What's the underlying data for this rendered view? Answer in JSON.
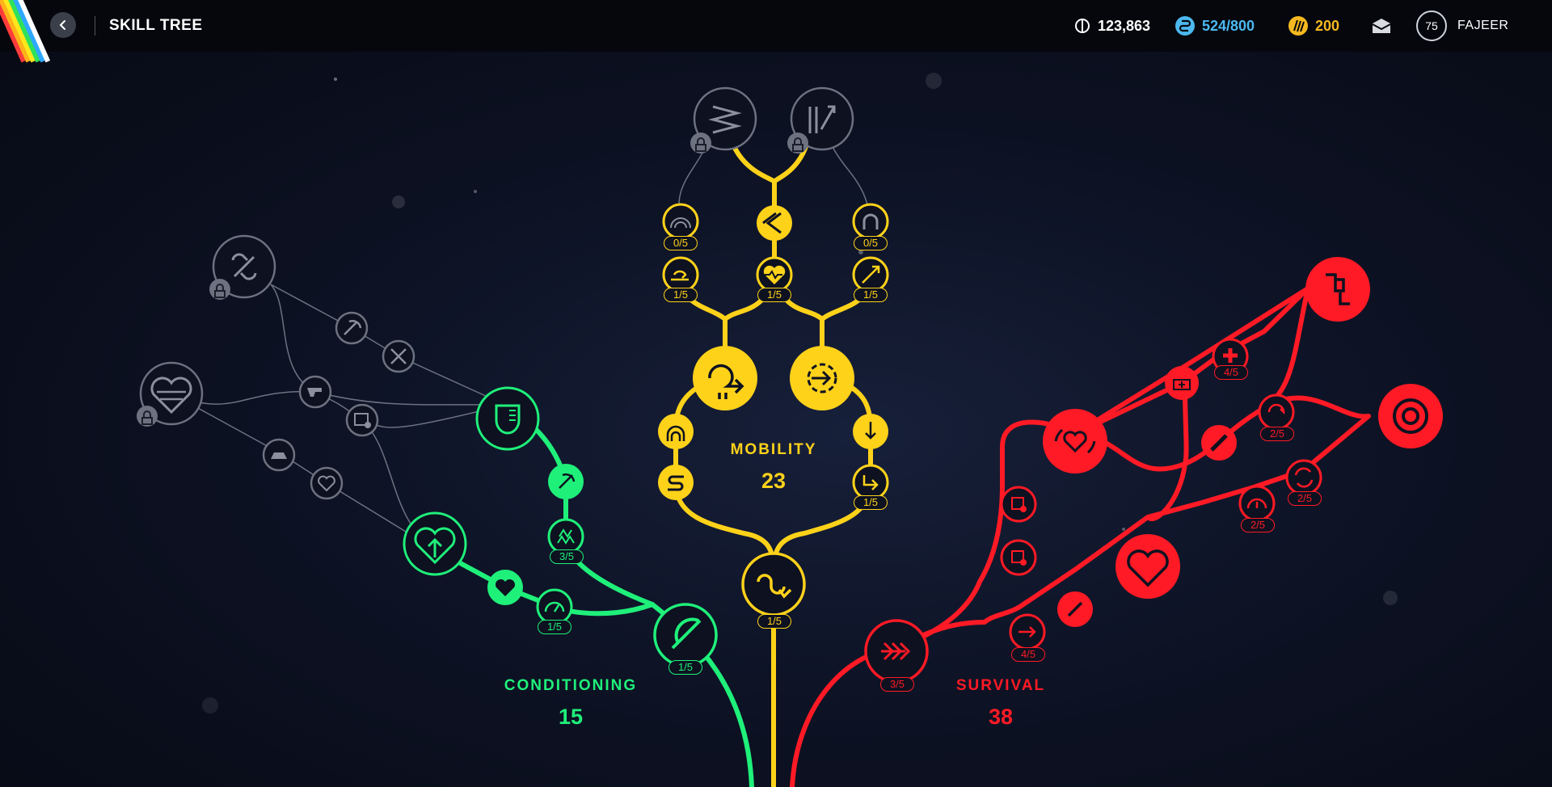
{
  "header": {
    "title": "SKILL TREE",
    "currency_1": "123,863",
    "currency_2": "524/800",
    "currency_3": "200",
    "level": "75",
    "username": "FAJEER"
  },
  "branches": {
    "mobility": {
      "name": "MOBILITY",
      "points": "23"
    },
    "conditioning": {
      "name": "CONDITIONING",
      "points": "15"
    },
    "survival": {
      "name": "SURVIVAL",
      "points": "38"
    }
  },
  "colors": {
    "mobility": "#ffd21a",
    "conditioning": "#1ff07a",
    "survival": "#ff1a25",
    "locked": "#6c7280",
    "currency_2": "#4cb8f0",
    "currency_3": "#f5b820"
  },
  "nodes": {
    "mobility": [
      {
        "id": "mob-locked-a",
        "icon": "zigzag-icon",
        "state": "locked"
      },
      {
        "id": "mob-locked-b",
        "icon": "diagonal-arrow-icon",
        "state": "locked"
      },
      {
        "id": "mob-a",
        "icon": "arc-icon",
        "rank": "0/5"
      },
      {
        "id": "mob-b",
        "icon": "chevron-icon"
      },
      {
        "id": "mob-c",
        "icon": "magnet-icon",
        "rank": "0/5"
      },
      {
        "id": "mob-d",
        "icon": "slide-icon",
        "rank": "1/5"
      },
      {
        "id": "mob-e",
        "icon": "heart-pulse-icon",
        "rank": "1/5"
      },
      {
        "id": "mob-f",
        "icon": "arrow-up-right-icon",
        "rank": "1/5"
      },
      {
        "id": "mob-g",
        "icon": "swirl-arrow-icon"
      },
      {
        "id": "mob-h",
        "icon": "dash-circle-icon"
      },
      {
        "id": "mob-i",
        "icon": "triple-arch-icon"
      },
      {
        "id": "mob-j",
        "icon": "drop-arrow-icon"
      },
      {
        "id": "mob-k",
        "icon": "s-curve-icon"
      },
      {
        "id": "mob-l",
        "icon": "corner-arrow-icon",
        "rank": "1/5"
      },
      {
        "id": "mob-root",
        "icon": "wave-arrow-icon",
        "rank": "1/5"
      }
    ],
    "conditioning": [
      {
        "id": "con-root",
        "icon": "feather-icon",
        "rank": "1/5"
      },
      {
        "id": "con-a",
        "icon": "shield-icon"
      },
      {
        "id": "con-b",
        "icon": "pickaxe-icon"
      },
      {
        "id": "con-c",
        "icon": "grass-icon",
        "rank": "3/5"
      },
      {
        "id": "con-d",
        "icon": "heart-arrow-icon"
      },
      {
        "id": "con-e",
        "icon": "heart-icon"
      },
      {
        "id": "con-f",
        "icon": "speed-icon",
        "rank": "1/5"
      }
    ],
    "survival": [
      {
        "id": "sur-root",
        "icon": "triple-chevron-icon",
        "rank": "3/5"
      },
      {
        "id": "sur-a",
        "icon": "arrow-icon",
        "rank": "4/5"
      },
      {
        "id": "sur-b",
        "icon": "wrench-icon"
      },
      {
        "id": "sur-c",
        "icon": "heart-refresh-icon"
      },
      {
        "id": "sur-d",
        "icon": "gauge-icon",
        "rank": "2/5"
      },
      {
        "id": "sur-e",
        "icon": "cycle-icon",
        "rank": "2/5"
      },
      {
        "id": "sur-f",
        "icon": "target-icon"
      },
      {
        "id": "sur-g",
        "icon": "bandage-icon"
      },
      {
        "id": "sur-h",
        "icon": "swap-icon",
        "rank": "2/5"
      },
      {
        "id": "sur-i",
        "icon": "card-icon"
      },
      {
        "id": "sur-j",
        "icon": "card-icon"
      },
      {
        "id": "sur-k",
        "icon": "heart-cycle-icon"
      },
      {
        "id": "sur-l",
        "icon": "medkit-icon"
      },
      {
        "id": "sur-m",
        "icon": "cross-icon",
        "rank": "4/5"
      },
      {
        "id": "sur-n",
        "icon": "doors-icon"
      }
    ],
    "locked": [
      {
        "id": "lock-a",
        "icon": "broken-link-icon",
        "state": "locked"
      },
      {
        "id": "lock-b",
        "icon": "striped-heart-icon",
        "state": "locked"
      },
      {
        "id": "lock-c",
        "icon": "pickaxe-icon"
      },
      {
        "id": "lock-d",
        "icon": "tools-icon"
      },
      {
        "id": "lock-e",
        "icon": "gun-icon"
      },
      {
        "id": "lock-f",
        "icon": "card-icon"
      },
      {
        "id": "lock-g",
        "icon": "car-icon"
      },
      {
        "id": "lock-h",
        "icon": "heart-outline-icon"
      }
    ]
  }
}
